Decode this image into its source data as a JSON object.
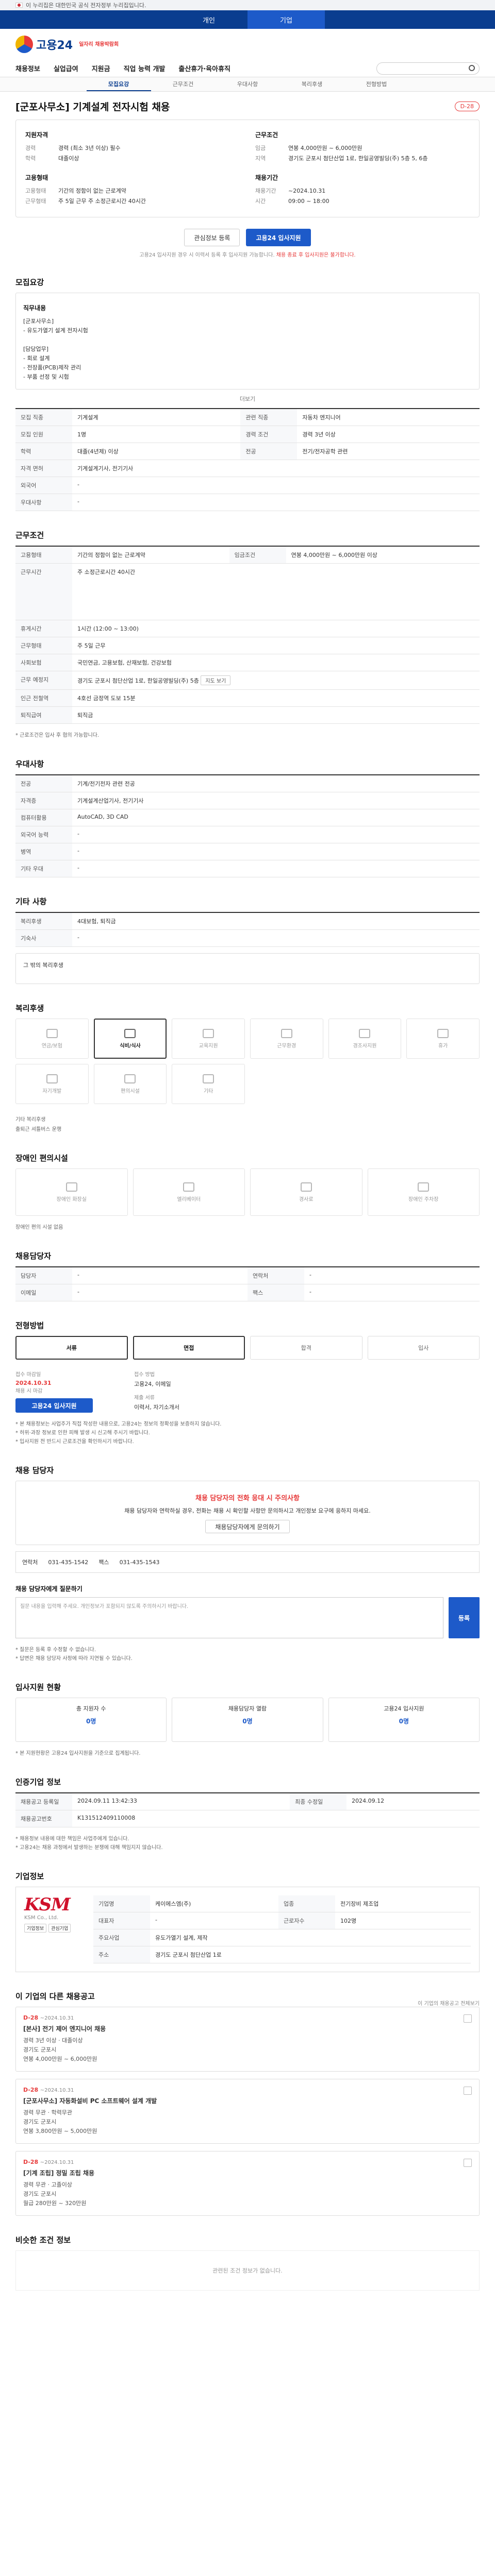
{
  "gov": {
    "text": "이 누리집은 대한민국 공식 전자정부 누리집입니다."
  },
  "topTabs": [
    "개인",
    "기업"
  ],
  "logo": {
    "name": "고용24",
    "event": "일자리 채용박람회"
  },
  "gnb": [
    "채용정보",
    "실업급여",
    "지원금",
    "직업 능력 개발",
    "출산휴가·육아휴직"
  ],
  "subtabs": [
    "모집요강",
    "근무조건",
    "우대사항",
    "복리후생",
    "전형방법"
  ],
  "job": {
    "title": "[군포사무소] 기계설계 전자시험 채용",
    "badge": "D-28",
    "sections": {
      "qual": "지원자격",
      "cond": "근무조건",
      "company": "고용형태",
      "recruit": "채용기간"
    },
    "left": [
      {
        "k": "경력",
        "v": "경력 (최소 3년 이상) 필수"
      },
      {
        "k": "학력",
        "v": "대졸이상"
      },
      {
        "k": "고용형태",
        "v": "기간의 정함이 없는 근로계약"
      },
      {
        "k": "근무형태",
        "v": "주 5일 근무 주 소정근로시간 40시간"
      }
    ],
    "right": [
      {
        "k": "임금",
        "v": "연봉 4,000만원 ~ 6,000만원"
      },
      {
        "k": "지역",
        "v": "경기도 군포시 첨단산업 1로, 한일공영빌딩(주) 5층 5, 6층"
      },
      {
        "k": "채용기간",
        "v": "~2024.10.31"
      },
      {
        "k": "시간",
        "v": "09:00 ~ 18:00"
      }
    ],
    "applyLabel": "관심정보 등록",
    "applyPrimary": "고용24 입사지원",
    "notice": "고용24 입사지원 경우 시 이력서 등록 후 입사지원 가능합니다.",
    "noticeRed": "채용 종료 후 입사지원은 불가합니다."
  },
  "recruit": {
    "heading": "모집요강",
    "dutyLabel": "직무내용",
    "duty": "[군포사무소]\n - 유도가열기 설계 전자시험\n\n[담당업무]\n - 회로 설계\n - 전장품(PCB)제작 관리\n - 부품 선정 및 시험",
    "more": "더보기",
    "rows": [
      [
        "모집 직종",
        "기계설계",
        "관련 직종",
        "자동차 엔지니어"
      ],
      [
        "모집 인원",
        "1명",
        "경력 조건",
        "경력 3년 이상"
      ],
      [
        "학력",
        "대졸(4년제) 이상",
        "전공",
        "전기/전자공학 관련"
      ],
      [
        "자격 면허",
        "기계설계기사, 전기기사"
      ],
      [
        "외국어",
        "-"
      ],
      [
        "우대사항",
        "-"
      ]
    ]
  },
  "cond": {
    "heading": "근무조건",
    "rows": [
      [
        "고용형태",
        "기간의 정함이 없는 근로계약",
        "임금조건",
        "연봉 4,000만원 ~ 6,000만원 이상"
      ],
      [
        "근무시간",
        "주 소정근로시간 40시간"
      ],
      [
        "휴게시간",
        "1시간 (12:00 ~ 13:00)"
      ],
      [
        "근무형태",
        "주 5일 근무"
      ],
      [
        "사회보험",
        "국민연금, 고용보험, 산재보험, 건강보험"
      ],
      [
        "근무 예정지",
        "경기도 군포시 첨단산업 1로, 한일공영빌딩(주) 5층"
      ],
      [
        "인근 전철역",
        "4호선 금정역 도보 15분"
      ],
      [
        "퇴직급여",
        "퇴직금"
      ]
    ],
    "mapBtn": "지도 보기",
    "note": "* 근로조건은 입사 후 협의 가능합니다."
  },
  "prefer": {
    "heading": "우대사항",
    "rows": [
      [
        "전공",
        "기계/전기전자 관련 전공"
      ],
      [
        "자격증",
        "기계설계산업기사, 전기기사"
      ],
      [
        "컴퓨터활용",
        "AutoCAD, 3D CAD"
      ],
      [
        "외국어 능력",
        "-"
      ],
      [
        "병역",
        "-"
      ],
      [
        "기타 우대",
        "-"
      ]
    ]
  },
  "welfare": {
    "heading": "기타 사항",
    "rows": [
      [
        "복리후생",
        "4대보험, 퇴직금"
      ],
      [
        "기숙사",
        "-"
      ]
    ],
    "etc": "그 밖의 복리후생"
  },
  "facility": {
    "heading": "복리후생",
    "icons": [
      "연금/보험",
      "식비/식사",
      "교육지원",
      "근무환경",
      "경조사지원",
      "휴가"
    ],
    "icons2": [
      "자기개발",
      "편의시설",
      "기타"
    ],
    "note": "기타 복리후생",
    "note2": "출퇴근 셔틀버스 운행"
  },
  "disabled": {
    "heading": "장애인 편의시설",
    "icons": [
      "장애인 화장실",
      "엘리베이터",
      "경사로",
      "장애인 주차장"
    ],
    "note": "장애인 편의 시설 없음"
  },
  "staff": {
    "heading": "채용담당자",
    "rows": [
      [
        "담당자",
        "-",
        "연락처",
        "-"
      ],
      [
        "이메일",
        "-",
        "팩스",
        "-"
      ]
    ]
  },
  "process": {
    "heading": "전형방법",
    "steps": [
      "서류",
      "면접",
      "합격",
      "입사"
    ],
    "deadlineLabel": "접수 마감일",
    "deadline": "2024.10.31",
    "deadlineNote": "채용 시 마감",
    "methodLabel": "접수 방법",
    "method": "고용24, 이메일",
    "docsLabel": "제출 서류",
    "docs": "이력서, 자기소개서",
    "applyBtn": "고용24 입사지원",
    "notes": "* 본 채용정보는 사업주가 직접 작성한 내용으로, 고용24는 정보의 정확성을 보증하지 않습니다.\n* 허위·과장 정보로 인한 피해 발생 시 신고해 주시기 바랍니다.\n* 입사지원 전 반드시 근로조건을 확인하시기 바랍니다."
  },
  "qna": {
    "heading": "채용 담당자",
    "title": "채용 담당자의 전화 응대 시 주의사항",
    "body": "채용 담당자와 연락하실 경우, 전화는 채용 시 확인할 사항만 문의하시고 개인정보 요구에 응하지 마세요.",
    "link": "채용담당자에게 문의하기",
    "phoneLabel": "연락처",
    "phone": "031-435-1542",
    "faxLabel": "팩스",
    "fax": "031-435-1543",
    "askLabel": "채용 담당자에게 질문하기",
    "placeholder": "질문 내용을 입력해 주세요. 개인정보가 포함되지 않도록 주의하시기 바랍니다.",
    "askBtn": "등록",
    "tips": "* 질문은 등록 후 수정할 수 없습니다.\n* 답변은 채용 담당자 사정에 따라 지연될 수 있습니다."
  },
  "status": {
    "heading": "입사지원 현황",
    "cards": [
      {
        "label": "총 지원자 수",
        "num": "0명"
      },
      {
        "label": "채용담당자 열람",
        "num": "0명"
      },
      {
        "label": "고용24 입사지원",
        "num": "0명"
      }
    ],
    "note": "* 본 지원현황은 고용24 입사지원을 기준으로 집계됩니다."
  },
  "info": {
    "heading": "인증기업 정보",
    "rows": [
      [
        "채용공고 등록일",
        "2024.09.11 13:42:33",
        "최종 수정일",
        "2024.09.12"
      ],
      [
        "채용공고번호",
        "K131512409110008"
      ]
    ],
    "notes": "* 채용정보 내용에 대한 책임은 사업주에게 있습니다.\n* 고용24는 채용 과정에서 발생하는 분쟁에 대해 책임지지 않습니다."
  },
  "company": {
    "heading": "기업정보",
    "mark": "KSM",
    "sub": "KSM Co., Ltd.",
    "btns": [
      "기업정보",
      "관심기업"
    ],
    "rows": [
      [
        "기업명",
        "케이에스엠(주)",
        "업종",
        "전기장비 제조업"
      ],
      [
        "대표자",
        "-",
        "근로자수",
        "102명"
      ],
      [
        "주요사업",
        "유도가열기 설계, 제작"
      ],
      [
        "주소",
        "경기도 군포시 첨단산업 1로"
      ]
    ]
  },
  "similar": {
    "heading": "이 기업의 다른 채용공고",
    "more": "이 기업의 채용공고 전체보기",
    "jobs": [
      {
        "dday": "D-28",
        "date": "~2024.10.31",
        "title": "[본사] 전기 제어 엔지니어 채용",
        "line1": "경력 3년 이상 · 대졸이상",
        "line2": "경기도 군포시",
        "line3": "연봉 4,000만원 ~ 6,000만원"
      },
      {
        "dday": "D-28",
        "date": "~2024.10.31",
        "title": "[군포사무소] 자동화설비 PC 소프트웨어 설계 개발",
        "line1": "경력 무관 · 학력무관",
        "line2": "경기도 군포시",
        "line3": "연봉 3,800만원 ~ 5,000만원"
      },
      {
        "dday": "D-28",
        "date": "~2024.10.31",
        "title": "[기계 조립] 정밀 조립 채용",
        "line1": "경력 무관 · 고졸이상",
        "line2": "경기도 군포시",
        "line3": "월급 280만원 ~ 320만원"
      }
    ]
  },
  "related": {
    "heading": "비슷한 조건 정보",
    "empty": "관련된 조건 정보가 없습니다."
  }
}
